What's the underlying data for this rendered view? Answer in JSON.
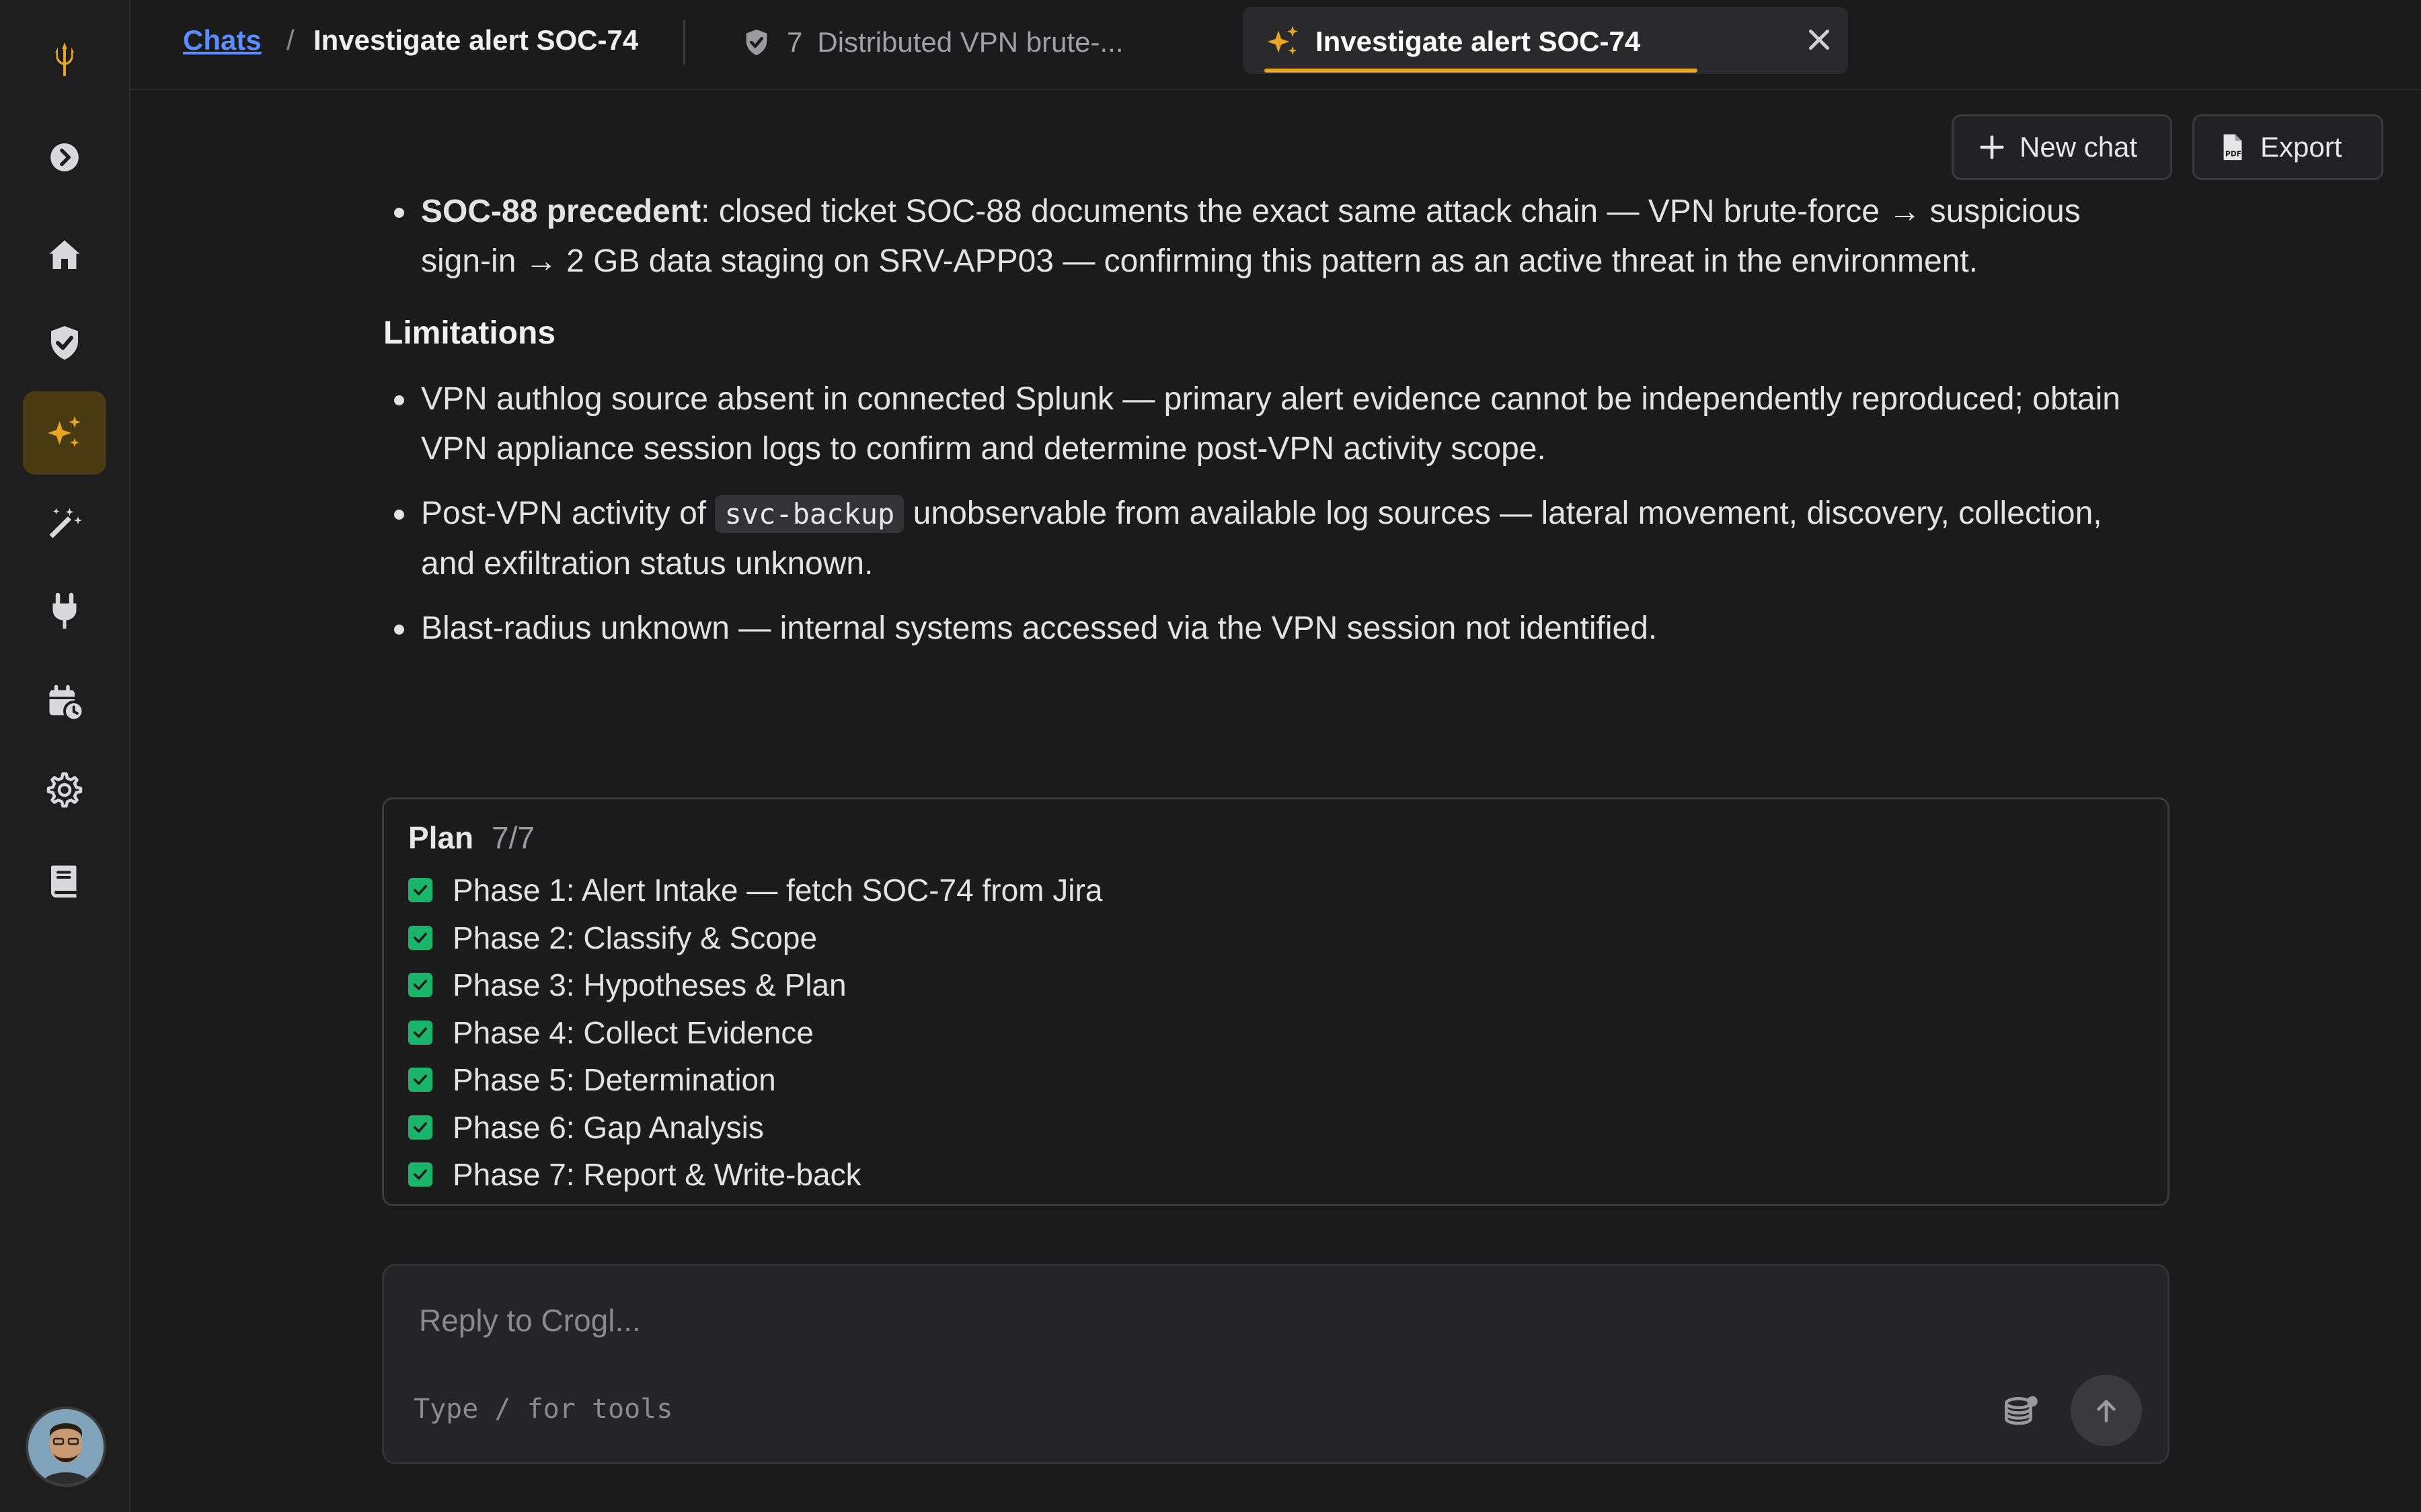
{
  "app": {
    "accent_color": "#e8a623",
    "success_color": "#19b56a",
    "link_color": "#5b8dff"
  },
  "sidebar": {
    "items": [
      {
        "name": "logo",
        "icon": "trident-logo-icon"
      },
      {
        "name": "expand",
        "icon": "chevron-right-circle-icon"
      },
      {
        "name": "home",
        "icon": "home-icon"
      },
      {
        "name": "security",
        "icon": "shield-check-icon"
      },
      {
        "name": "ai-chat",
        "icon": "sparkles-icon",
        "active": true
      },
      {
        "name": "magic",
        "icon": "magic-wand-icon"
      },
      {
        "name": "integrations",
        "icon": "plug-icon"
      },
      {
        "name": "schedule",
        "icon": "calendar-clock-icon"
      },
      {
        "name": "settings",
        "icon": "gear-icon"
      },
      {
        "name": "docs",
        "icon": "book-icon"
      }
    ],
    "avatar_icon": "user-avatar"
  },
  "header": {
    "breadcrumb_link": "Chats",
    "breadcrumb_sep": "/",
    "breadcrumb_current": "Investigate alert SOC-74",
    "tab1_count": "7",
    "tab1_label": "Distributed VPN brute-...",
    "tab2_label": "Investigate alert SOC-74"
  },
  "actions": {
    "new_chat": "New chat",
    "export": "Export"
  },
  "content": {
    "first_bullet_bold": "SOC-88 precedent",
    "first_bullet_rest": ": closed ticket SOC-88 documents the exact same attack chain — VPN brute-force → suspicious sign-in → 2 GB data staging on SRV-APP03 — confirming this pattern as an active threat in the environment.",
    "limitations_title": "Limitations",
    "lim1": "VPN authlog source absent in connected Splunk — primary alert evidence cannot be independently reproduced; obtain VPN appliance session logs to confirm and determine post-VPN activity scope.",
    "lim2_pre": "Post-VPN activity of ",
    "lim2_code": "svc-backup",
    "lim2_post": " unobservable from available log sources — lateral movement, discovery, collection, and exfiltration status unknown.",
    "lim3": "Blast-radius unknown — internal systems accessed via the VPN session not identified."
  },
  "plan": {
    "title": "Plan",
    "count": "7/7",
    "items": [
      {
        "label": "Phase 1: Alert Intake — fetch SOC-74 from Jira",
        "checked": true
      },
      {
        "label": "Phase 2: Classify & Scope",
        "checked": true
      },
      {
        "label": "Phase 3: Hypotheses & Plan",
        "checked": true
      },
      {
        "label": "Phase 4: Collect Evidence",
        "checked": true
      },
      {
        "label": "Phase 5: Determination",
        "checked": true
      },
      {
        "label": "Phase 6: Gap Analysis",
        "checked": true
      },
      {
        "label": "Phase 7: Report & Write-back",
        "checked": true
      }
    ]
  },
  "reply": {
    "placeholder": "Reply to Crogl...",
    "hint": "Type / for tools"
  }
}
